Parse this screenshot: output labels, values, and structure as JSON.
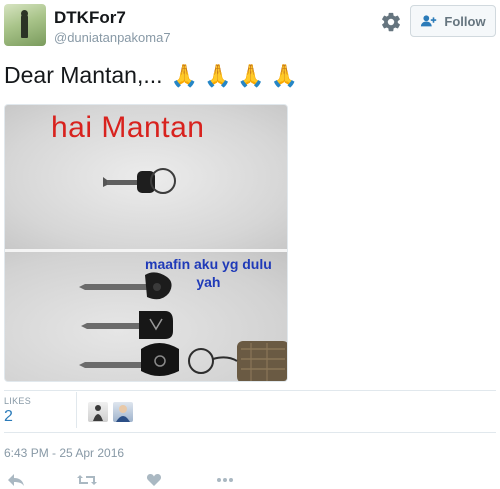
{
  "tweet": {
    "author_name": "DTKFor7",
    "author_handle": "@duniatanpakoma7",
    "follow_label": "Follow",
    "text": "Dear Mantan,...",
    "emoji": [
      "🙏",
      "🙏",
      "🙏",
      "🙏"
    ],
    "image_caption_top": "hai Mantan",
    "image_caption_bottom_1": "maafin aku yg dulu",
    "image_caption_bottom_2": "yah",
    "likes_label": "LIKES",
    "likes_count": "2",
    "timestamp": "6:43 PM - 25 Apr 2016"
  },
  "icons": {
    "settings": "gear-icon",
    "follow": "add-user-icon",
    "reply": "reply-icon",
    "retweet": "retweet-icon",
    "like": "heart-icon",
    "more": "more-icon"
  },
  "colors": {
    "link_blue": "#2b7bb9",
    "muted": "#8899a6",
    "caption_red": "#d8221e",
    "caption_blue": "#1f3ab8"
  }
}
